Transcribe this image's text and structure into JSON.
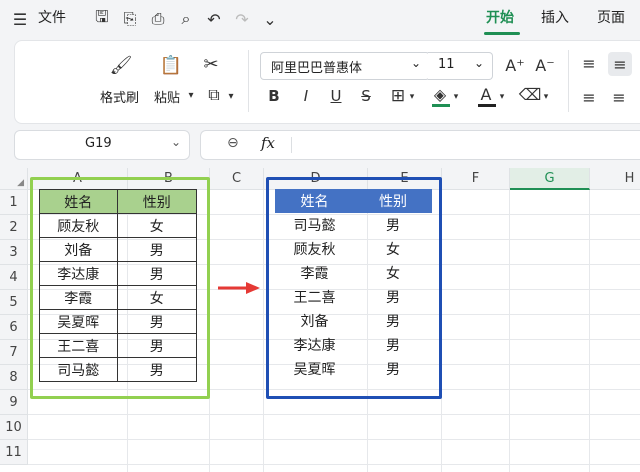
{
  "menubar": {
    "file_label": "文件",
    "tabs": [
      "开始",
      "插入",
      "页面"
    ]
  },
  "ribbon": {
    "format_painter": "格式刷",
    "paste": "粘贴",
    "font_name": "阿里巴巴普惠体",
    "font_size": "11",
    "bold": "B",
    "italic": "I",
    "underline": "U",
    "strike": "S",
    "font_color": "A"
  },
  "formula_bar": {
    "cell_ref": "G19",
    "fx_label": "fx",
    "value": ""
  },
  "sheet": {
    "columns": [
      "A",
      "B",
      "C",
      "D",
      "E",
      "F",
      "G",
      "H"
    ],
    "rows": [
      "1",
      "2",
      "3",
      "4",
      "5",
      "6",
      "7",
      "8",
      "9",
      "10",
      "11"
    ],
    "selected_column": "G"
  },
  "table_left": {
    "headers": [
      "姓名",
      "性别"
    ],
    "rows": [
      [
        "顾友秋",
        "女"
      ],
      [
        "刘备",
        "男"
      ],
      [
        "李达康",
        "男"
      ],
      [
        "李霞",
        "女"
      ],
      [
        "吴夏晖",
        "男"
      ],
      [
        "王二喜",
        "男"
      ],
      [
        "司马懿",
        "男"
      ]
    ]
  },
  "table_right": {
    "headers": [
      "姓名",
      "性别"
    ],
    "rows": [
      [
        "司马懿",
        "男"
      ],
      [
        "顾友秋",
        "女"
      ],
      [
        "李霞",
        "女"
      ],
      [
        "王二喜",
        "男"
      ],
      [
        "刘备",
        "男"
      ],
      [
        "李达康",
        "男"
      ],
      [
        "吴夏晖",
        "男"
      ]
    ]
  },
  "colors": {
    "accent": "#1f8f54",
    "left_header_fill": "#a9d18e",
    "left_frame": "#92d050",
    "right_header_fill": "#4472c4",
    "right_frame": "#1f4fb4",
    "arrow": "#e53935"
  }
}
